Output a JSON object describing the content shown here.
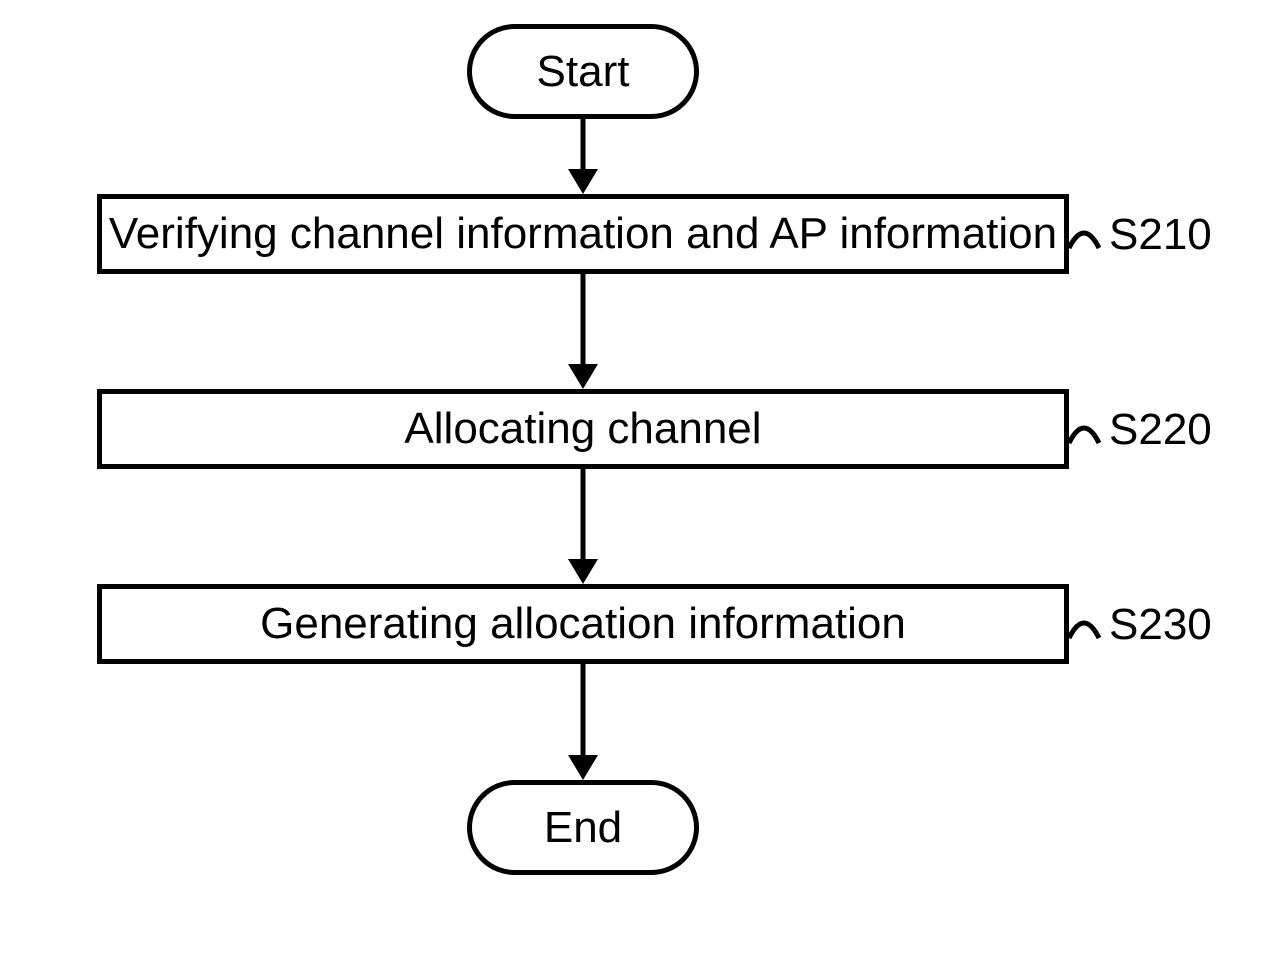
{
  "diagram": {
    "start": "Start",
    "end": "End",
    "steps": [
      {
        "text": "Verifying channel information and AP information",
        "label": "S210"
      },
      {
        "text": "Allocating channel",
        "label": "S220"
      },
      {
        "text": "Generating allocation information",
        "label": "S230"
      }
    ]
  }
}
